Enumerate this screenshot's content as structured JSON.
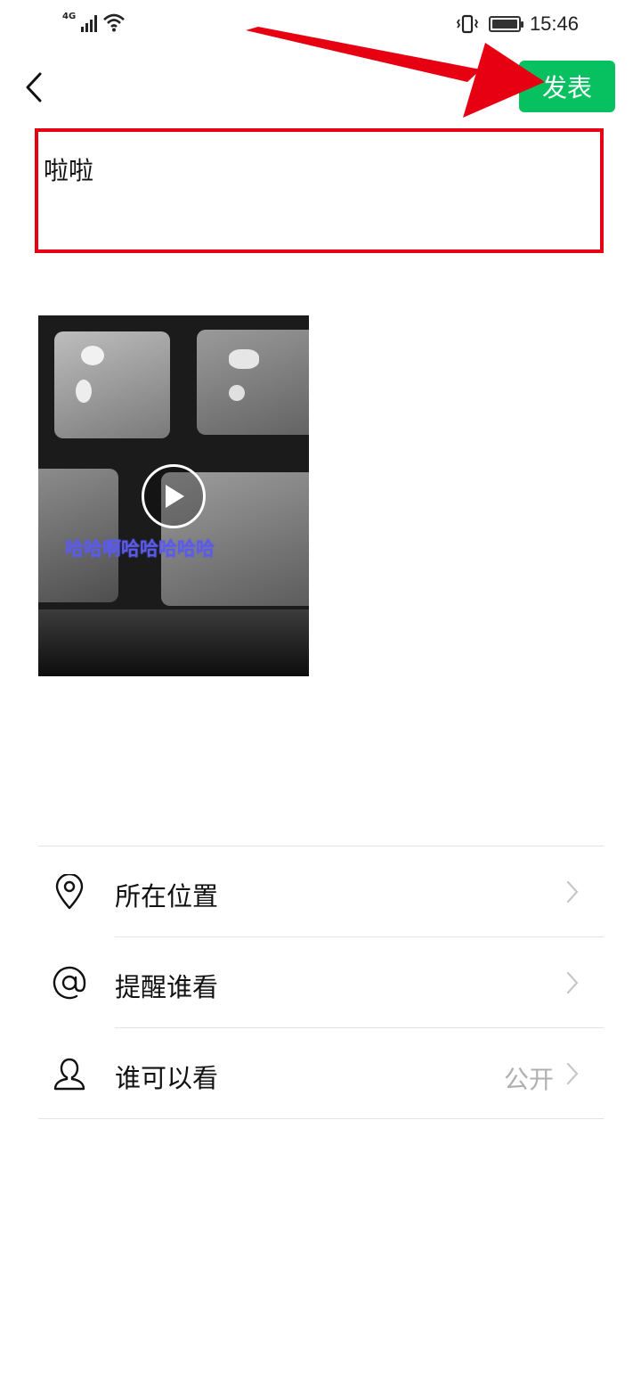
{
  "status_bar": {
    "network_label": "4G",
    "time": "15:46"
  },
  "header": {
    "back_icon": "chevron-left-icon",
    "publish_label": "发表",
    "publish_color": "#07c160"
  },
  "post": {
    "text": "啦啦"
  },
  "video": {
    "caption": "哈哈啊哈哈哈哈哈",
    "play_icon": "play-icon"
  },
  "settings": {
    "items": [
      {
        "label": "所在位置",
        "icon": "location-pin-icon",
        "value": ""
      },
      {
        "label": "提醒谁看",
        "icon": "at-sign-icon",
        "value": ""
      },
      {
        "label": "谁可以看",
        "icon": "person-icon",
        "value": "公开"
      }
    ]
  },
  "annotation": {
    "color": "#e60012"
  }
}
